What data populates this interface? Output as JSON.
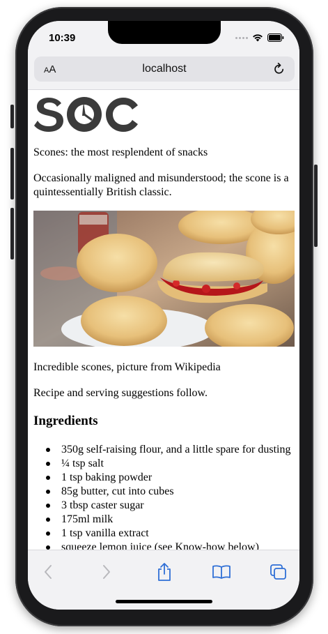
{
  "status_bar": {
    "time": "10:39"
  },
  "browser": {
    "text_size_button": {
      "small": "A",
      "large": "A"
    },
    "url": "localhost",
    "accent_color": "#2f6fd6"
  },
  "page": {
    "logo_text": "SOC",
    "headline": "Scones: the most resplendent of snacks",
    "intro": "Occasionally maligned and misunderstood; the scone is a quintessentially British classic.",
    "caption": "Incredible scones, picture from Wikipedia",
    "recipe_note": "Recipe and serving suggestions follow.",
    "ingredients_heading": "Ingredients",
    "ingredients": [
      "350g self-raising flour, and a little spare for dusting",
      "¼ tsp salt",
      "1 tsp baking powder",
      "85g butter, cut into cubes",
      "3 tbsp caster sugar",
      "175ml milk",
      "1 tsp vanilla extract",
      "squeeze lemon juice (see Know-how below)"
    ]
  },
  "toolbar": {
    "icons": [
      "back-icon",
      "forward-icon",
      "share-icon",
      "bookmarks-icon",
      "tabs-icon"
    ]
  }
}
